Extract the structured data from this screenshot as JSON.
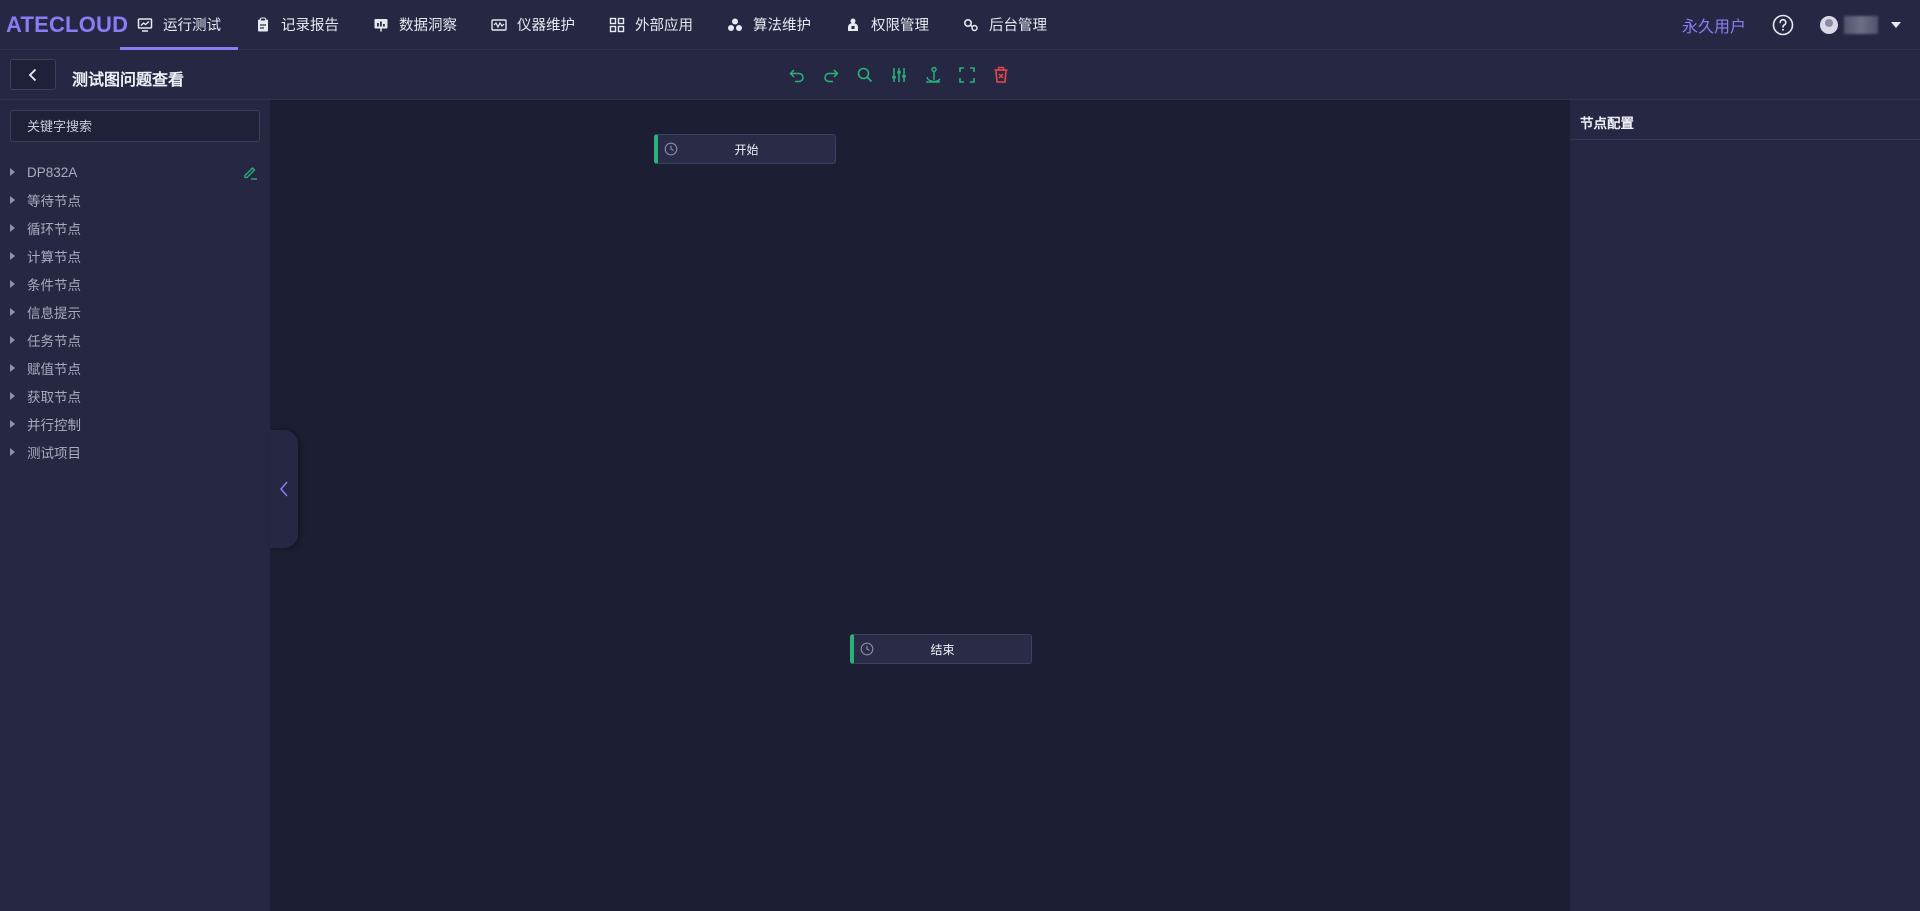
{
  "app": {
    "logo": "ATECLOUD"
  },
  "nav": {
    "items": [
      {
        "label": "运行测试",
        "icon": "monitor-chart-icon",
        "active": true
      },
      {
        "label": "记录报告",
        "icon": "clipboard-icon",
        "active": false
      },
      {
        "label": "数据洞察",
        "icon": "data-screen-icon",
        "active": false
      },
      {
        "label": "仪器维护",
        "icon": "instrument-icon",
        "active": false
      },
      {
        "label": "外部应用",
        "icon": "grid-apps-icon",
        "active": false
      },
      {
        "label": "算法维护",
        "icon": "algorithm-icon",
        "active": false
      },
      {
        "label": "权限管理",
        "icon": "permission-icon",
        "active": false
      },
      {
        "label": "后台管理",
        "icon": "admin-gear-icon",
        "active": false
      }
    ]
  },
  "header_right": {
    "user_type": "永久用户"
  },
  "page": {
    "title": "测试图问题查看"
  },
  "toolbar": {
    "tools": [
      "undo-icon",
      "redo-icon",
      "zoom-search-icon",
      "adjust-sliders-icon",
      "anchor-icon",
      "fullscreen-icon",
      "delete-icon"
    ],
    "accent": "#29b37a",
    "danger": "#e5484d"
  },
  "left_panel": {
    "search_placeholder": "关键字搜索",
    "tree": [
      {
        "label": "DP832A",
        "editable": true
      },
      {
        "label": "等待节点"
      },
      {
        "label": "循环节点"
      },
      {
        "label": "计算节点"
      },
      {
        "label": "条件节点"
      },
      {
        "label": "信息提示"
      },
      {
        "label": "任务节点"
      },
      {
        "label": "赋值节点"
      },
      {
        "label": "获取节点"
      },
      {
        "label": "并行控制"
      },
      {
        "label": "测试项目"
      }
    ]
  },
  "canvas": {
    "nodes": [
      {
        "id": "start",
        "label": "开始"
      },
      {
        "id": "end",
        "label": "结束"
      }
    ]
  },
  "right_panel": {
    "title": "节点配置"
  },
  "colors": {
    "accent_purple": "#8b7cf6",
    "accent_green": "#29b37a",
    "panel": "#262843",
    "canvas": "#1c1e33"
  }
}
